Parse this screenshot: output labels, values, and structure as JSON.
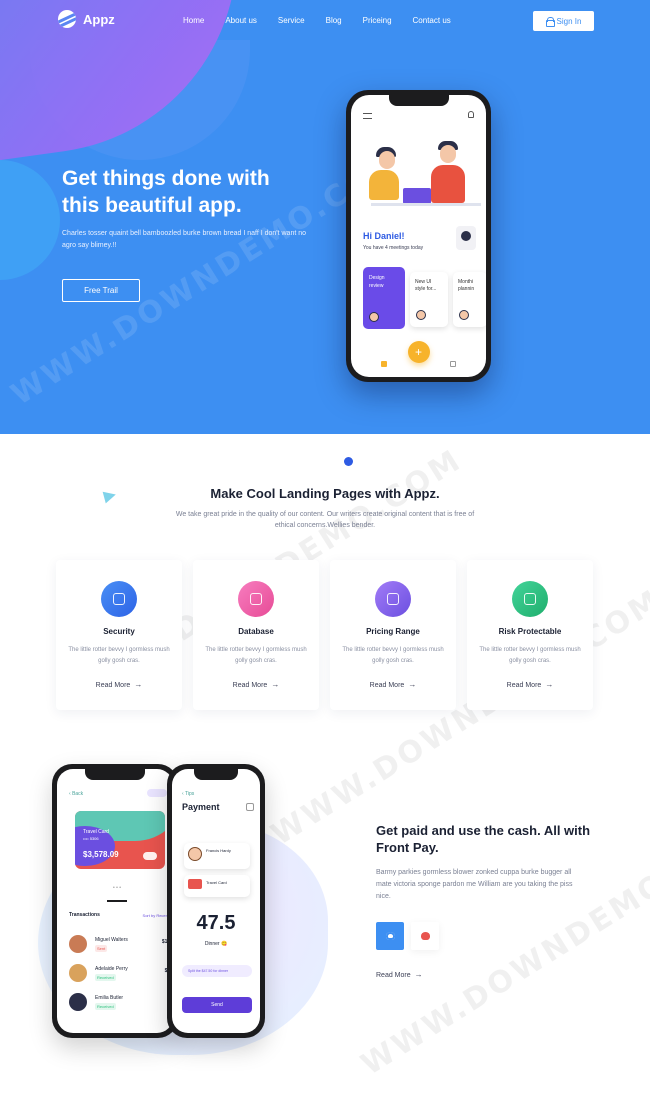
{
  "brand": {
    "name": "Appz"
  },
  "nav": {
    "items": [
      "Home",
      "About us",
      "Service",
      "Blog",
      "Priceing",
      "Contact us"
    ],
    "signin_label": "Sign In"
  },
  "hero": {
    "title_line1": "Get things done with",
    "title_line2": "this beautiful app.",
    "description": "Charles tosser quaint bell bamboozled burke brown bread I naff I don't want no agro say blimey.!!",
    "cta_label": "Free Trail",
    "phone": {
      "greeting": "Hi Daniel!",
      "subtitle": "You have 4 meetings today",
      "card1_line1": "Design",
      "card1_line2": "review",
      "card2_line1": "New UI",
      "card2_line2": "style for...",
      "card3_line1": "Monthi",
      "card3_line2": "plannin",
      "fab_symbol": "+"
    }
  },
  "features_section": {
    "title": "Make Cool Landing Pages with Appz.",
    "description": "We take great pride in the quality of our content. Our writers create original content that is free of ethical concerns.Wellies bender.",
    "items": [
      {
        "title": "Security",
        "desc": "The little rotter bevvy I gormless mush golly gosh cras.",
        "more": "Read More",
        "color": "#3d7ff0"
      },
      {
        "title": "Database",
        "desc": "The little rotter bevvy I gormless mush golly gosh cras.",
        "more": "Read More",
        "color": "#f05fa6"
      },
      {
        "title": "Pricing Range",
        "desc": "The little rotter bevvy I gormless mush golly gosh cras.",
        "more": "Read More",
        "color": "#8a63f0"
      },
      {
        "title": "Risk Protectable",
        "desc": "The little rotter bevvy I gormless mush golly gosh cras.",
        "more": "Read More",
        "color": "#2ec27e"
      }
    ]
  },
  "payment_section": {
    "title": "Get paid and use the cash. All with Front Pay.",
    "description": "Barmy parkies gormless blower zonked cuppa burke bugger all mate victoria sponge pardon me William are you taking the piss nice.",
    "more": "Read More",
    "wallet_phone": {
      "back": "Back",
      "card_name": "Travel Card",
      "card_number": "•••• 5306",
      "card_amount": "$3,578.09",
      "dots": "• • •",
      "transactions_label": "Transactions",
      "sort_label": "Sort by Recent",
      "transactions": [
        {
          "name": "Miguel Walters",
          "tag": "Sent",
          "amount": "$124",
          "tag_color": "#e8544e",
          "avatar": "#c97b55"
        },
        {
          "name": "Adelaide Perry",
          "tag": "Received",
          "amount": "$34",
          "tag_color": "#2ec27e",
          "avatar": "#d9a25c"
        },
        {
          "name": "Emilia Butler",
          "tag": "Received",
          "amount": "$7",
          "tag_color": "#2ec27e",
          "avatar": "#2b2f48"
        }
      ]
    },
    "payment_phone": {
      "back": "Tips",
      "title": "Payment",
      "user_name": "Francis Hardy",
      "card_label": "Travel Card",
      "amount": "47.5",
      "note": "Dinner 😋",
      "message": "Split the $47.50 for dinner",
      "send_label": "Send"
    }
  },
  "watermark": "WWW.DOWNDEMO.COM"
}
